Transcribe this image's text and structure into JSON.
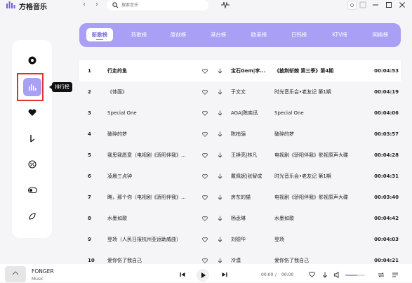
{
  "app": {
    "title": "方格音乐"
  },
  "search": {
    "placeholder": "搜索音乐"
  },
  "tooltip": {
    "text": "排行榜"
  },
  "tabs": [
    {
      "label": "新歌榜",
      "active": true
    },
    {
      "label": "热歌榜"
    },
    {
      "label": "原创榜"
    },
    {
      "label": "港台榜"
    },
    {
      "label": "欧美榜"
    },
    {
      "label": "日韩榜"
    },
    {
      "label": "KTV榜"
    },
    {
      "label": "网络榜"
    }
  ],
  "songs": [
    {
      "num": "1",
      "name": "行走的鱼",
      "artist": "宝石Gem|李...",
      "album": "《披荆斩棘 第三季》第4期",
      "time": "00:04:53"
    },
    {
      "num": "2",
      "name": "《体面》",
      "artist": "于文文",
      "album": "时光音乐会•老友记 第1期",
      "time": "00:04:19"
    },
    {
      "num": "3",
      "name": "Special One",
      "artist": "AGA|陈奕迅",
      "album": "Special One",
      "time": "00:04:06"
    },
    {
      "num": "4",
      "name": "破碎的梦",
      "artist": "陈柏骊",
      "album": "破碎的梦",
      "time": "00:03:57"
    },
    {
      "num": "5",
      "name": "我思我愿意（电视剧《骄阳伴我》...",
      "artist": "王铮亮|林凡",
      "album": "电视剧《骄阳伴我》影视原声大碟",
      "time": "00:04:28"
    },
    {
      "num": "6",
      "name": "凌晨三点钟",
      "artist": "戴佩妮|张智成",
      "album": "时光音乐会•老友记 第1期",
      "time": "00:04:31"
    },
    {
      "num": "7",
      "name": "瞧，那个你（电视剧《骄阳伴我》...",
      "artist": "房东的猫",
      "album": "电视剧《骄阳伴我》影视原声大碟",
      "time": "00:03:40"
    },
    {
      "num": "8",
      "name": "水墨如歌",
      "artist": "杨丞琳",
      "album": "水墨如歌",
      "time": "00:04:42"
    },
    {
      "num": "9",
      "name": "登场（人民日报杭州亚运助威曲）",
      "artist": "刘德华",
      "album": "登场",
      "time": "00:04:03"
    },
    {
      "num": "10",
      "name": "爱你伤了我自己",
      "artist": "冷漠",
      "album": "爱你伤了我自己",
      "time": "00:04:21"
    }
  ],
  "player": {
    "title": "FONGER",
    "artist": "Music",
    "current_time": "00:00",
    "separator": "/",
    "total_time": "00:00",
    "volume": 0.6
  },
  "colors": {
    "accent": "#a99ff5",
    "highlight_border": "#e0322e"
  }
}
